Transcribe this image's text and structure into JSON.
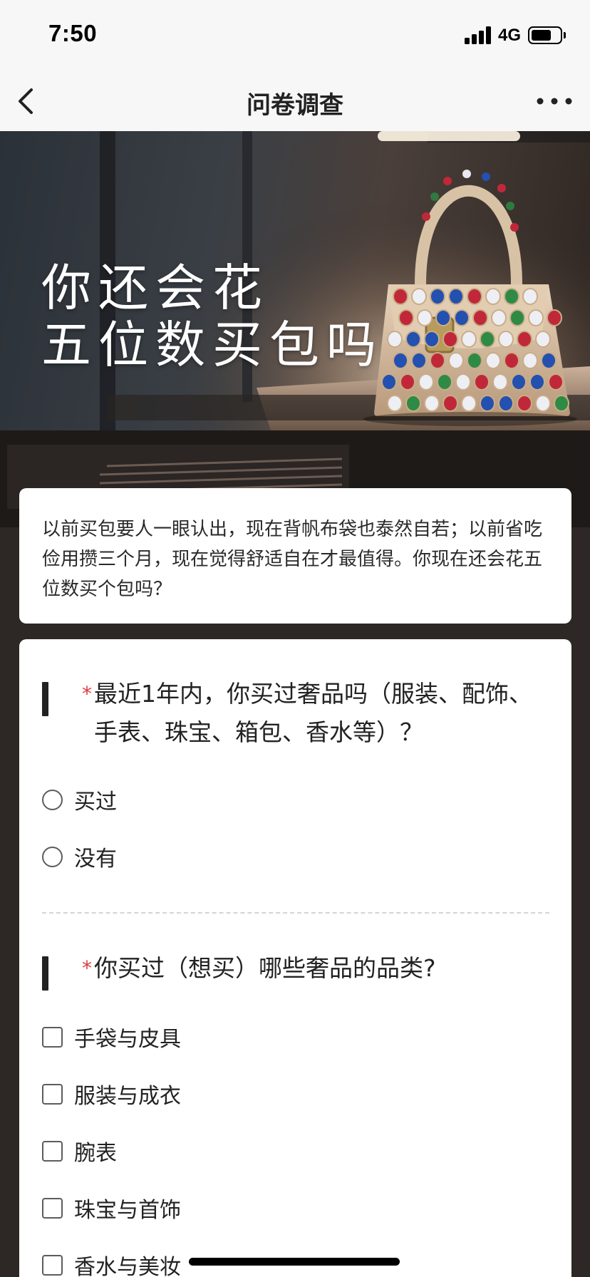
{
  "status_bar": {
    "time": "7:50",
    "network": "4G",
    "battery_level": 0.7,
    "signal_bars": 4
  },
  "nav": {
    "title": "问卷调查",
    "back_icon": "chevron-left-icon",
    "more_icon": "more-dots-icon"
  },
  "banner": {
    "headline_line1": "你还会花",
    "headline_line2": "五位数买包吗",
    "image": "jeweled-handbag-photo"
  },
  "intro": {
    "text": "以前买包要人一眼认出，现在背帆布袋也泰然自若；以前省吃俭用攒三个月，现在觉得舒适自在才最值得。你现在还会花五位数买个包吗？"
  },
  "questions": [
    {
      "required_mark": "*",
      "title": "最近1年内，你买过奢品吗（服装、配饰、手表、珠宝、箱包、香水等）？",
      "type": "radio",
      "options": [
        "买过",
        "没有"
      ]
    },
    {
      "required_mark": "*",
      "title": "你买过（想买）哪些奢品的品类?",
      "type": "checkbox",
      "options": [
        "手袋与皮具",
        "服装与成衣",
        "腕表",
        "珠宝与首饰",
        "香水与美妆"
      ]
    }
  ],
  "colors": {
    "required": "#e03a3a",
    "background": "#2d2726",
    "card": "#ffffff"
  }
}
